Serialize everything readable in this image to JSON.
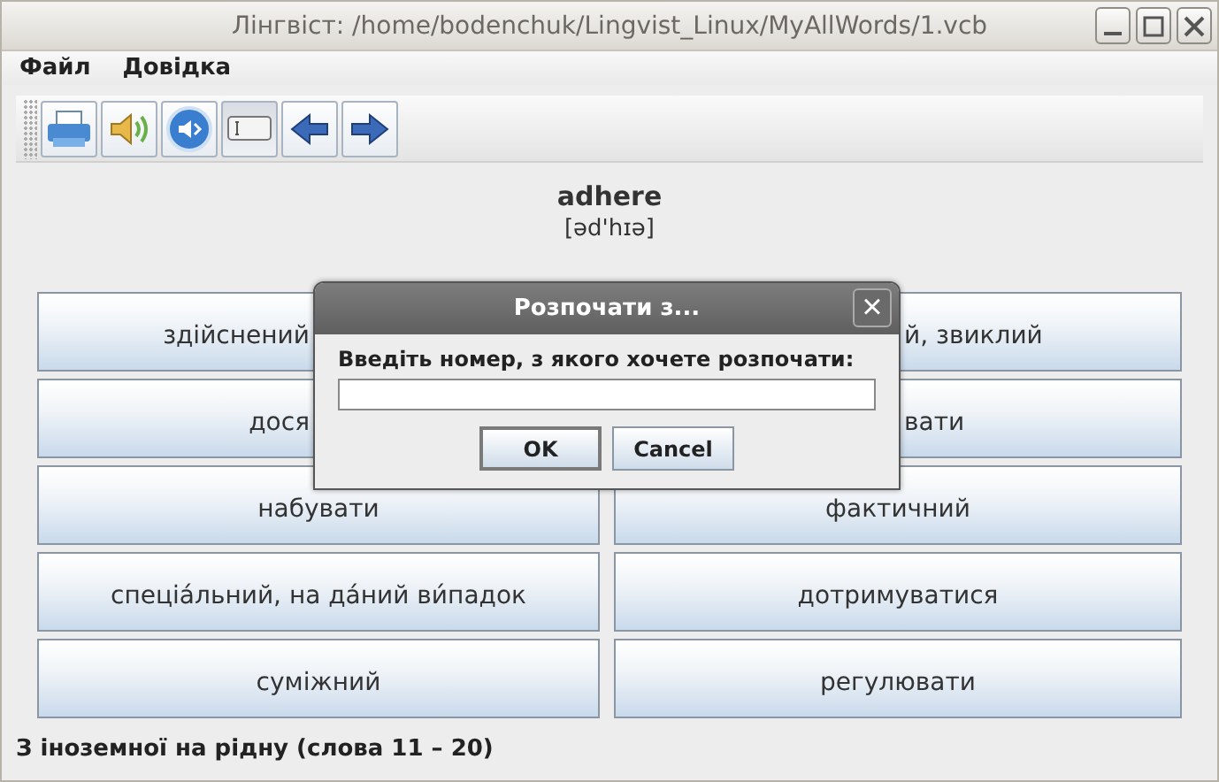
{
  "window": {
    "title": "Лінгвіст: /home/bodenchuk/Lingvist_Linux/MyAllWords/1.vcb"
  },
  "menu": [
    "Файл",
    "Довідка"
  ],
  "toolbar": [
    {
      "kind": "print",
      "selected": false
    },
    {
      "kind": "speaker",
      "selected": false
    },
    {
      "kind": "mute",
      "selected": false
    },
    {
      "kind": "field",
      "selected": true
    },
    {
      "kind": "back",
      "selected": false
    },
    {
      "kind": "forward",
      "selected": false
    }
  ],
  "word": "adhere",
  "transcription": "[əd'hɪə]",
  "answers": [
    {
      "text": "здійснений",
      "partly_hidden": true
    },
    {
      "text": "й, звиклий",
      "partly_hidden": true
    },
    {
      "text": "дося",
      "partly_hidden": true
    },
    {
      "text": "вати",
      "partly_hidden": true
    },
    {
      "text": "набувати",
      "partly_hidden": false
    },
    {
      "text": "фактичний",
      "partly_hidden": false
    },
    {
      "text": "спеціа́льний, на да́ний ви́падок",
      "partly_hidden": false
    },
    {
      "text": "дотримуватися",
      "partly_hidden": false
    },
    {
      "text": "суміжний",
      "partly_hidden": false
    },
    {
      "text": "регулювати",
      "partly_hidden": false
    }
  ],
  "status_bar": "З іноземної на рідну (слова 11 – 20)",
  "dialog": {
    "title": "Розпочати з...",
    "close": "×",
    "prompt": "Введіть номер, з якого хочете розпочати:",
    "buttons": [
      {
        "label": "OK",
        "selected": true
      },
      {
        "label": "Cancel",
        "selected": false
      }
    ]
  }
}
